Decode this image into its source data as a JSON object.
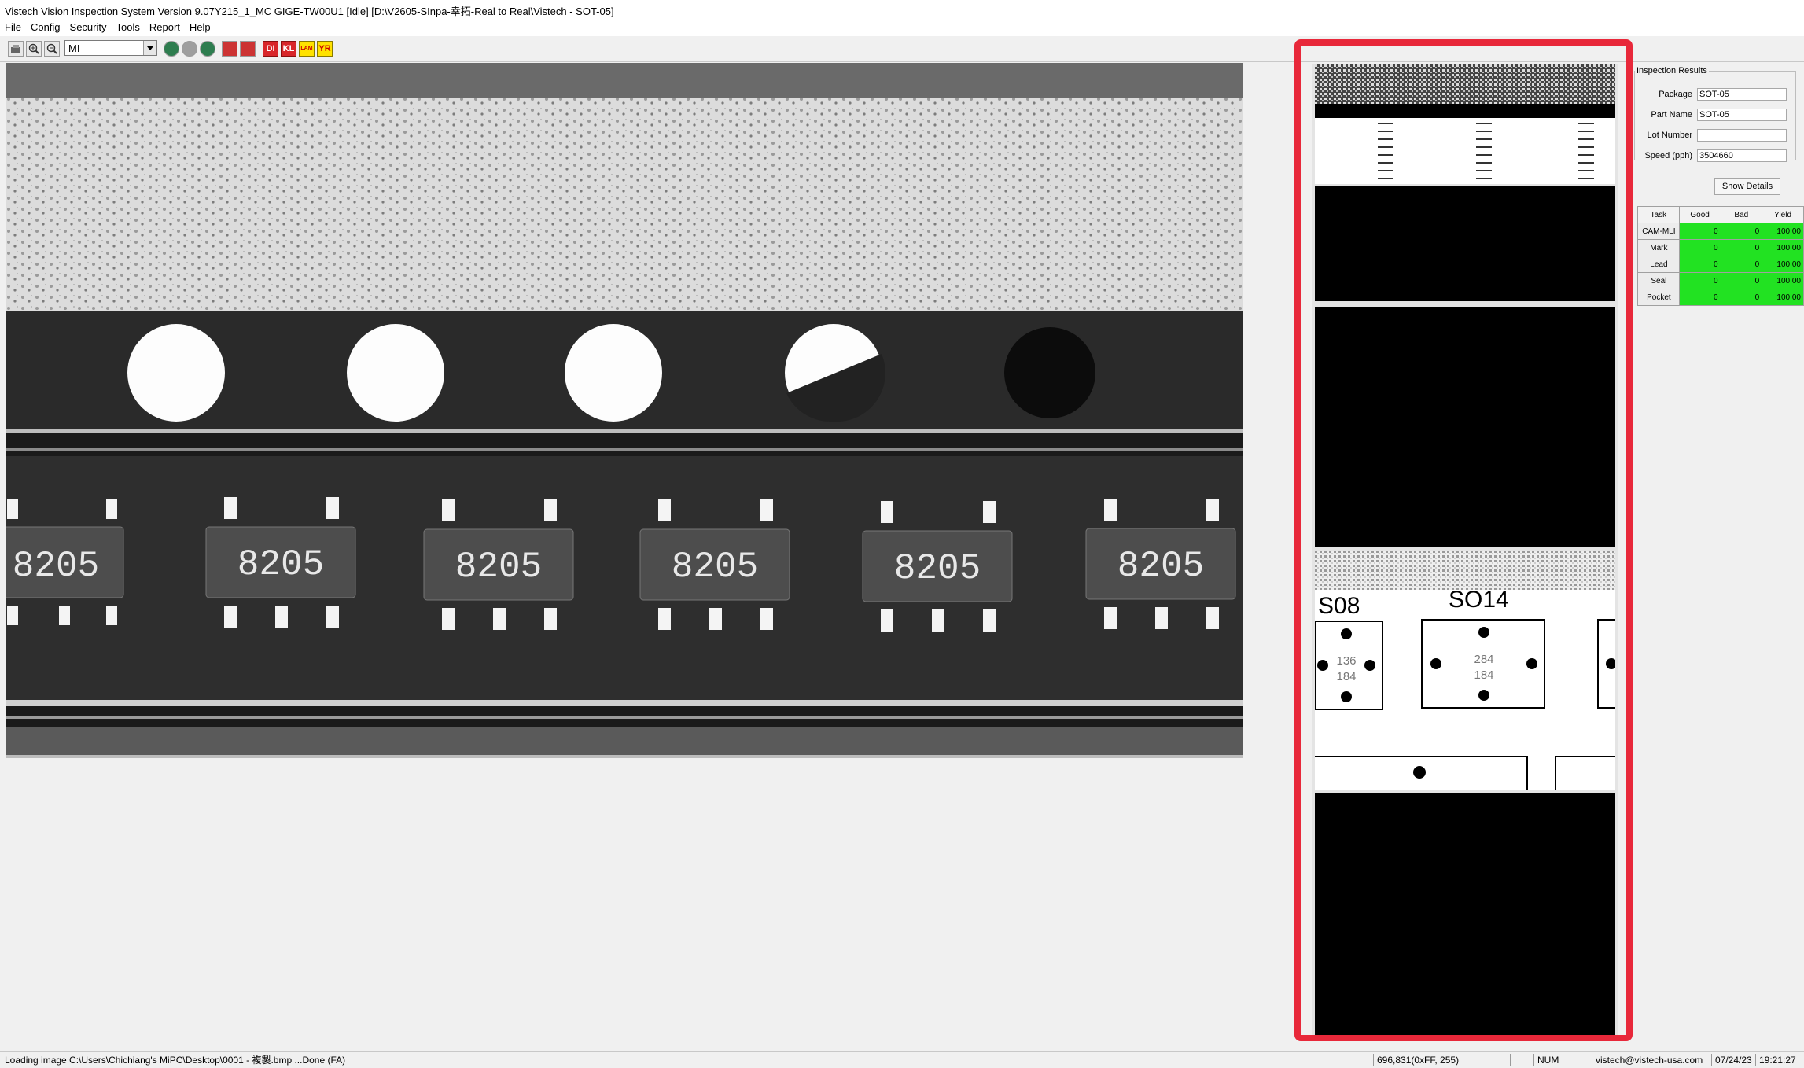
{
  "window": {
    "title": "Vistech Vision Inspection System Version 9.07Y215_1_MC GIGE-TW00U1 [Idle] [D:\\V2605-SInpa-幸拓-Real to Real\\Vistech - SOT-05]"
  },
  "menu": [
    "File",
    "Config",
    "Security",
    "Tools",
    "Report",
    "Help"
  ],
  "toolbar": {
    "mode_value": "MI",
    "buttons": [
      "open-icon",
      "zoom-in-icon",
      "zoom-out-icon",
      "run-icon",
      "stop-icon",
      "step-icon",
      "camera-icon",
      "camera2-icon",
      "DI",
      "KL",
      "LAM",
      "YR"
    ],
    "di_label": "DI",
    "kl_label": "KL",
    "lam_label": "LAM",
    "yr_label": "YR"
  },
  "main_image": {
    "chip_marks": [
      "8205",
      "8205",
      "8205",
      "8205",
      "8205",
      "8205"
    ]
  },
  "thumbnails": {
    "label_s08": "S08",
    "label_s014": "SO14",
    "pad_left_top": "136",
    "pad_left_bottom": "184",
    "pad_right_top": "284",
    "pad_right_bottom": "184"
  },
  "results": {
    "legend": "Inspection Results",
    "fields": [
      {
        "label": "Package",
        "value": "SOT-05"
      },
      {
        "label": "Part Name",
        "value": "SOT-05"
      },
      {
        "label": "Lot Number",
        "value": ""
      },
      {
        "label": "Speed (pph)",
        "value": "3504660"
      }
    ],
    "show_details": "Show Details",
    "table": {
      "headers": [
        "Task",
        "Good",
        "Bad",
        "Yield"
      ],
      "rows": [
        {
          "task": "CAM-MLI",
          "good": "0",
          "bad": "0",
          "yield": "100.00"
        },
        {
          "task": "Mark",
          "good": "0",
          "bad": "0",
          "yield": "100.00"
        },
        {
          "task": "Lead",
          "good": "0",
          "bad": "0",
          "yield": "100.00"
        },
        {
          "task": "Seal",
          "good": "0",
          "bad": "0",
          "yield": "100.00"
        },
        {
          "task": "Pocket",
          "good": "0",
          "bad": "0",
          "yield": "100.00"
        }
      ]
    }
  },
  "status": {
    "message": "Loading image C:\\Users\\Chichiang's MiPC\\Desktop\\0001 - 複製.bmp ...Done (FA)",
    "coords": "696,831(0xFF, 255)",
    "num": "NUM",
    "email": "vistech@vistech-usa.com",
    "date": "07/24/23",
    "time": "19:21:27"
  },
  "colors": {
    "highlight": "#e8283a",
    "yield_green": "#22e222"
  }
}
